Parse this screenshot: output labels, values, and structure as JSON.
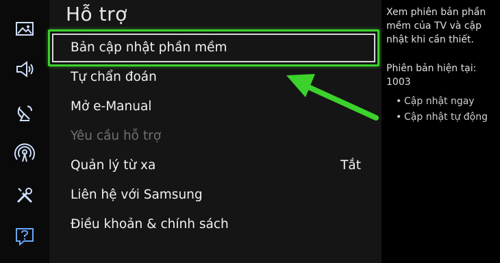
{
  "sidebar": {
    "items": [
      {
        "icon": "picture-icon"
      },
      {
        "icon": "sound-icon"
      },
      {
        "icon": "broadcast-icon"
      },
      {
        "icon": "network-icon"
      },
      {
        "icon": "tools-icon"
      },
      {
        "icon": "support-icon"
      }
    ]
  },
  "panel": {
    "title": "Hỗ trợ",
    "items": [
      {
        "label": "Bản cập nhật phần mềm",
        "value": "",
        "state": "focused"
      },
      {
        "label": "Tự chẩn đoán",
        "value": "",
        "state": "normal"
      },
      {
        "label": "Mở e-Manual",
        "value": "",
        "state": "normal"
      },
      {
        "label": "Yêu cầu hỗ trợ",
        "value": "",
        "state": "disabled"
      },
      {
        "label": "Quản lý từ xa",
        "value": "Tắt",
        "state": "normal"
      },
      {
        "label": "Liên hệ với Samsung",
        "value": "",
        "state": "normal"
      },
      {
        "label": "Điều khoản & chính sách",
        "value": "",
        "state": "normal"
      }
    ]
  },
  "info": {
    "description": "Xem phiên bản phần mềm của TV và cập nhật khi cần thiết.",
    "version_label": "Phiên bản hiện tại:",
    "version_value": "1003",
    "bullet": "•",
    "options": [
      "Cập nhật ngay",
      "Cập nhật tự động"
    ]
  },
  "colors": {
    "focus_highlight": "#3cd22c",
    "annotation_arrow": "#3cd22c",
    "disabled_text": "#707070"
  }
}
